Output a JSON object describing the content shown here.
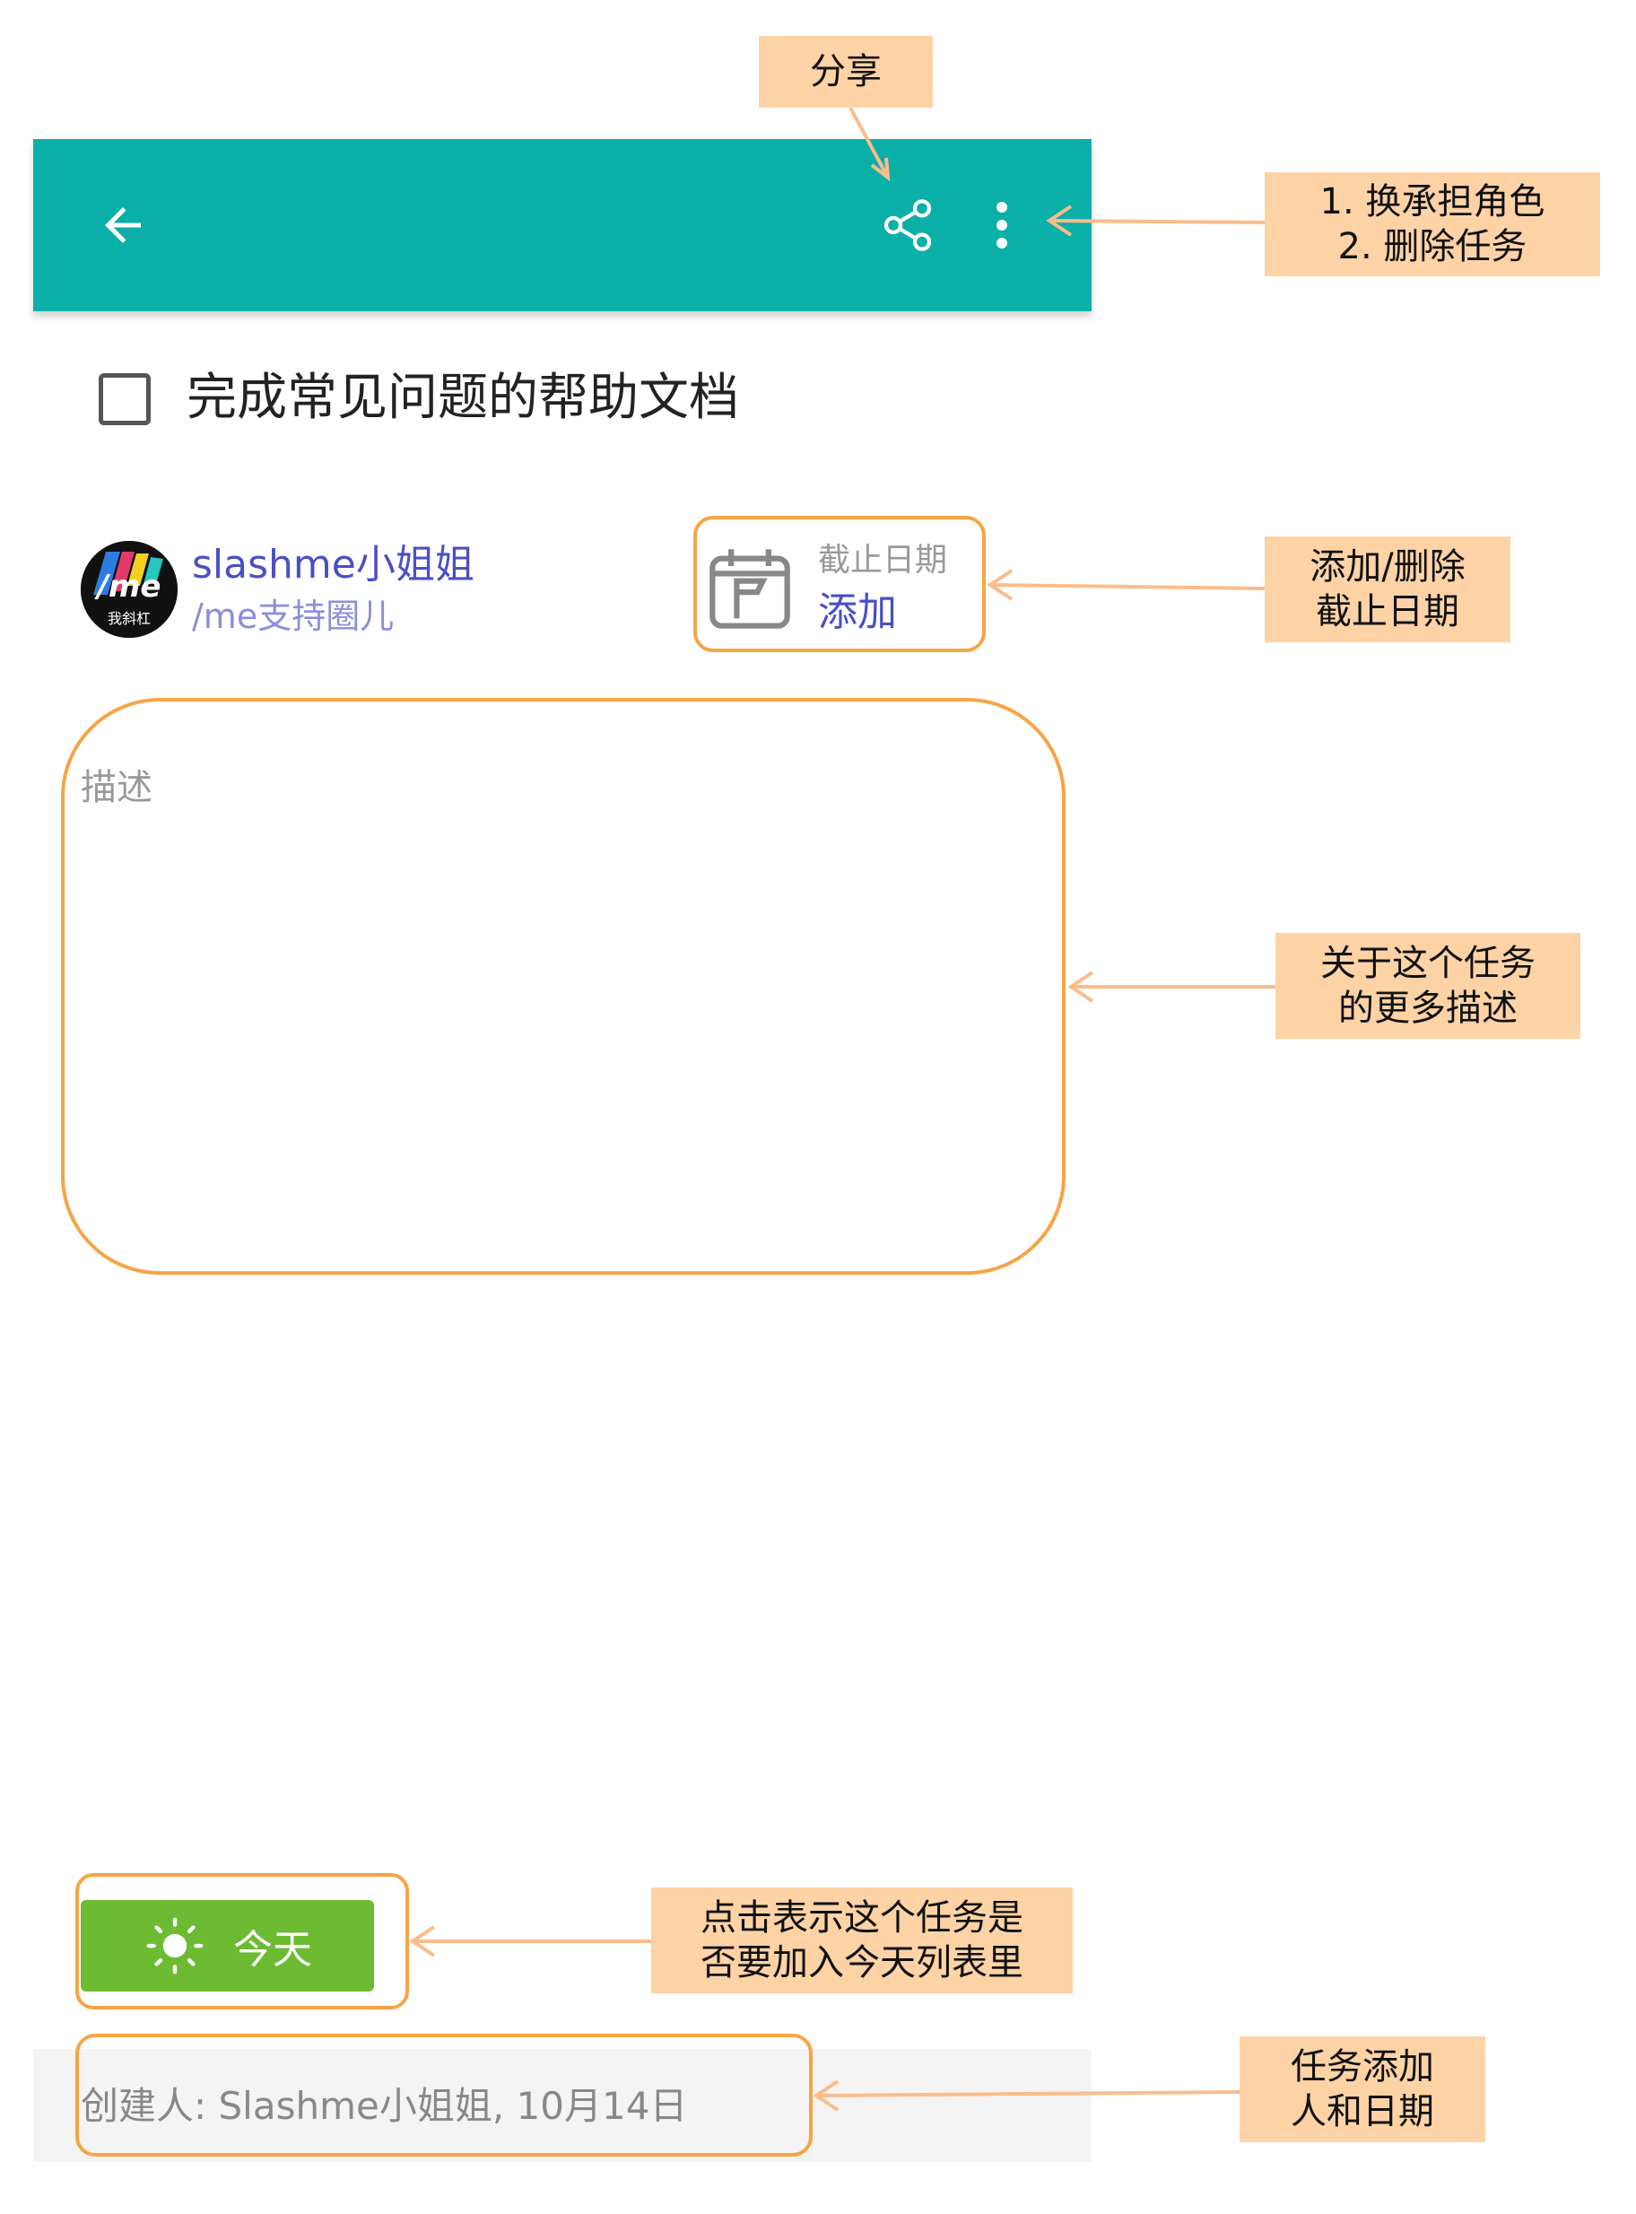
{
  "appbar": {
    "back_icon": "arrow-left-icon",
    "share_icon": "share-icon",
    "more_icon": "more-vert-icon",
    "color": "#0aafa8"
  },
  "task": {
    "title": "完成常见问题的帮助文档",
    "checked": false
  },
  "assignee": {
    "name": "slashme小姐姐",
    "group": "/me支持圈儿",
    "avatar_text": "/me",
    "avatar_sub": "我斜杠"
  },
  "due_date": {
    "label": "截止日期",
    "action": "添加",
    "icon": "calendar-flag-icon"
  },
  "description": {
    "placeholder": "描述"
  },
  "today_button": {
    "label": "今天",
    "icon": "sun-icon",
    "color": "#6cbb32"
  },
  "footer": {
    "created_text": "创建人: Slashme小姐姐, 10月14日"
  },
  "callouts": {
    "share": "分享",
    "more": "1. 换承担角色\n2. 删除任务",
    "due": "添加/删除\n截止日期",
    "description": "关于这个任务\n的更多描述",
    "today": "点击表示这个任务是\n否要加入今天列表里",
    "creator": "任务添加\n人和日期"
  },
  "colors": {
    "highlight": "#f7a444",
    "callout_bg": "#fdd3a6",
    "link": "#4a4fc4"
  }
}
